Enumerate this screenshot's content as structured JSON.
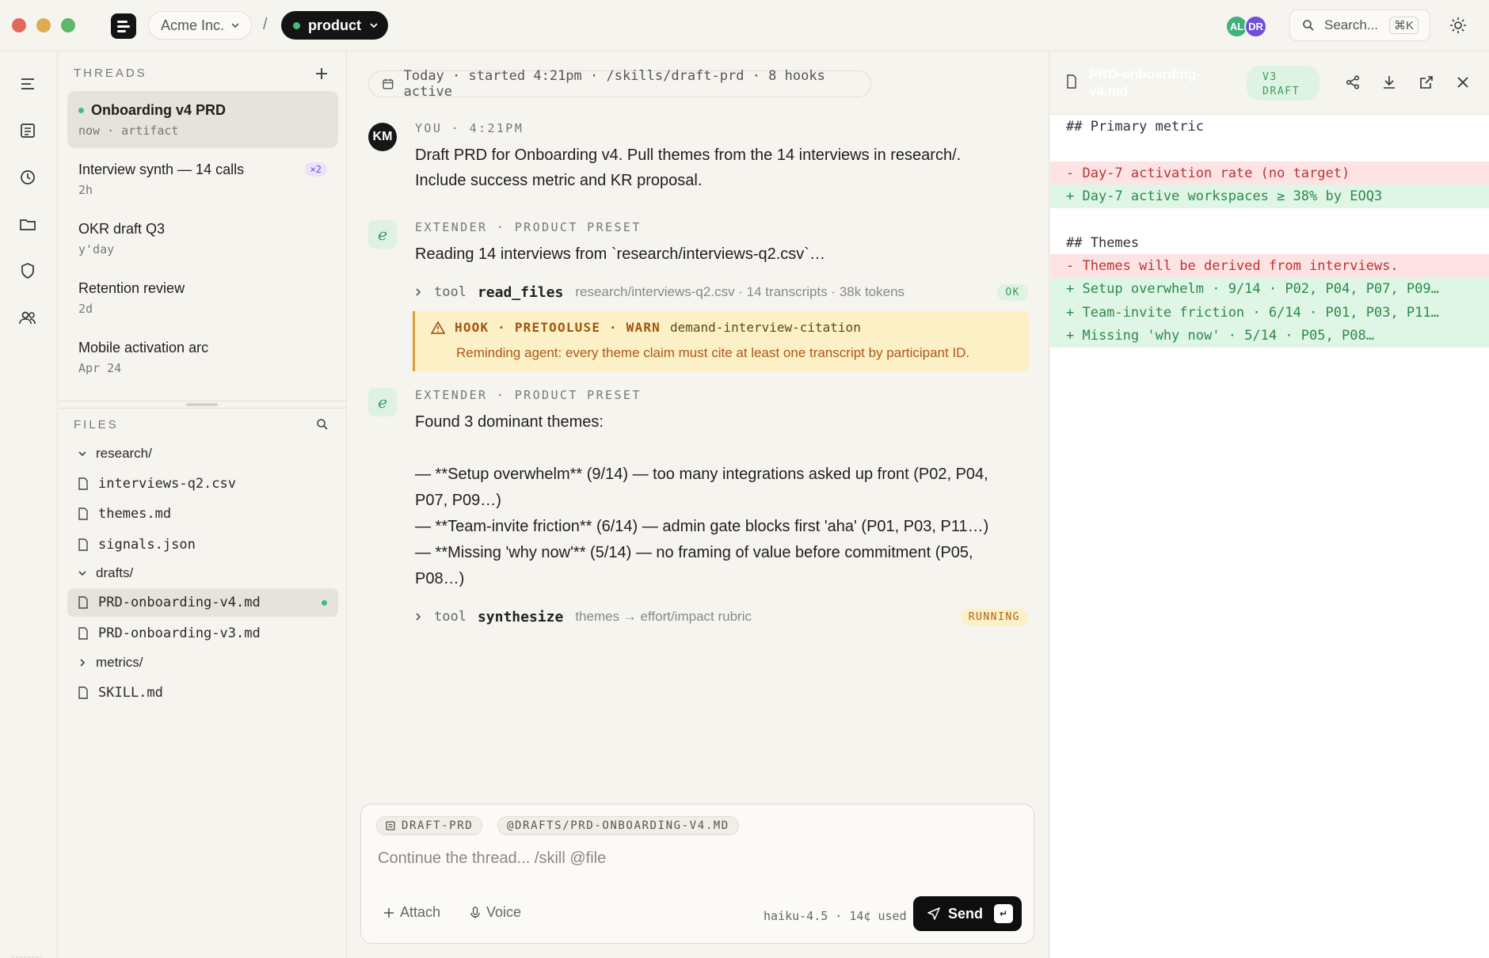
{
  "topbar": {
    "org": "Acme Inc.",
    "separator": "/",
    "project": "product",
    "avatars": [
      {
        "initials": "AL",
        "color": "#3fb27a"
      },
      {
        "initials": "DR",
        "color": "#6f4fd8"
      }
    ],
    "search_placeholder": "Search...",
    "search_shortcut": "⌘K"
  },
  "threads": {
    "heading": "THREADS",
    "items": [
      {
        "title": "Onboarding v4 PRD",
        "meta": "now · artifact",
        "active": true
      },
      {
        "title": "Interview synth — 14 calls",
        "meta": "2h",
        "badge": "×2"
      },
      {
        "title": "OKR draft Q3",
        "meta": "y'day"
      },
      {
        "title": "Retention review",
        "meta": "2d"
      },
      {
        "title": "Mobile activation arc",
        "meta": "Apr 24"
      }
    ]
  },
  "files": {
    "heading": "FILES",
    "items": [
      {
        "name": "research/",
        "type": "folder",
        "open": true
      },
      {
        "name": "interviews-q2.csv",
        "type": "file"
      },
      {
        "name": "themes.md",
        "type": "file"
      },
      {
        "name": "signals.json",
        "type": "file"
      },
      {
        "name": "drafts/",
        "type": "folder",
        "open": true
      },
      {
        "name": "PRD-onboarding-v4.md",
        "type": "file",
        "active": true
      },
      {
        "name": "PRD-onboarding-v3.md",
        "type": "file"
      },
      {
        "name": "metrics/",
        "type": "folder",
        "open": false
      },
      {
        "name": "SKILL.md",
        "type": "file"
      }
    ]
  },
  "conversation": {
    "context": "Today · started 4:21pm · /skills/draft-prd · 8 hooks active",
    "messages": [
      {
        "avatar": "KM",
        "meta": "YOU · 4:21PM",
        "lines": [
          "Draft PRD for Onboarding v4. Pull themes from the 14 interviews in research/.",
          "Include success metric and KR proposal."
        ]
      },
      {
        "avatar": "e",
        "meta": "EXTENDER · PRODUCT PRESET",
        "lines": [
          "Reading 14 interviews from `research/interviews-q2.csv`…"
        ],
        "tool": {
          "label": "tool",
          "name": "read_files",
          "detail": "research/interviews-q2.csv · 14 transcripts · 38k tokens",
          "status": "OK"
        },
        "hook": {
          "label": "HOOK · PRETOOLUSE · WARN",
          "name": "demand-interview-citation",
          "message": "Reminding agent: every theme claim must cite at least one transcript by participant ID."
        }
      },
      {
        "avatar": "e",
        "meta": "EXTENDER · PRODUCT PRESET",
        "lines": [
          "Found 3 dominant themes:",
          "",
          "— **Setup overwhelm** (9/14) — too many integrations asked up front (P02, P04,",
          "P07, P09…)",
          "— **Team-invite friction** (6/14) — admin gate blocks first 'aha' (P01, P03, P11…)",
          "— **Missing 'why now'** (5/14) — no framing of value before commitment (P05,",
          "P08…)"
        ],
        "tool": {
          "label": "tool",
          "name": "synthesize",
          "detail": "themes → effort/impact rubric",
          "status": "RUNNING"
        }
      }
    ]
  },
  "composer": {
    "chips": [
      "DRAFT-PRD",
      "@DRAFTS/PRD-ONBOARDING-V4.MD"
    ],
    "placeholder": "Continue the thread... /skill @file",
    "attach": "Attach",
    "voice": "Voice",
    "model": "haiku-4.5 · 14¢ used",
    "send": "Send",
    "send_key": "↵"
  },
  "artifact": {
    "filename": "PRD-onboarding-v4.md",
    "badge": "V3 DRAFT",
    "lines": [
      {
        "kind": "ctx",
        "text": "## Primary metric"
      },
      {
        "kind": "blank",
        "text": ""
      },
      {
        "kind": "del",
        "text": "- Day-7 activation rate (no target)"
      },
      {
        "kind": "add",
        "text": "+ Day-7 active workspaces ≥ 38% by EOQ3"
      },
      {
        "kind": "blank",
        "text": ""
      },
      {
        "kind": "ctx",
        "text": "## Themes"
      },
      {
        "kind": "del",
        "text": "- Themes will be derived from interviews."
      },
      {
        "kind": "add",
        "text": "+ Setup overwhelm · 9/14 · P02, P04, P07, P09…"
      },
      {
        "kind": "add",
        "text": "+ Team-invite friction · 6/14 · P01, P03, P11…"
      },
      {
        "kind": "add",
        "text": "+ Missing 'why now' · 5/14 · P05, P08…"
      }
    ]
  },
  "colors": {
    "accent_green": "#3fbf7a",
    "brand_dark": "#141414",
    "diff_add_bg": "#dff5e5",
    "diff_del_bg": "#fde3e3",
    "warn_bg": "#fcf0c6"
  }
}
